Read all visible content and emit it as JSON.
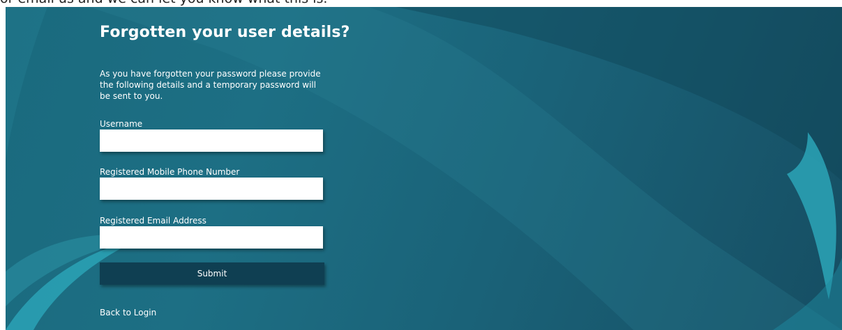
{
  "top_text": "or email us and we can let you know what this is.",
  "form": {
    "title": "Forgotten your user details?",
    "intro": "As you have forgotten your password please provide the following details and a temporary password will be sent to you.",
    "fields": [
      {
        "label": "Username",
        "value": "",
        "placeholder": ""
      },
      {
        "label": "Registered Mobile Phone Number",
        "value": "",
        "placeholder": ""
      },
      {
        "label": "Registered Email Address",
        "value": "",
        "placeholder": ""
      }
    ],
    "submit_label": "Submit",
    "back_link": "Back to Login"
  },
  "colors": {
    "background": "#1a6a7e",
    "button": "#0f3f52",
    "accent_swoosh": "#2aa0b3"
  }
}
